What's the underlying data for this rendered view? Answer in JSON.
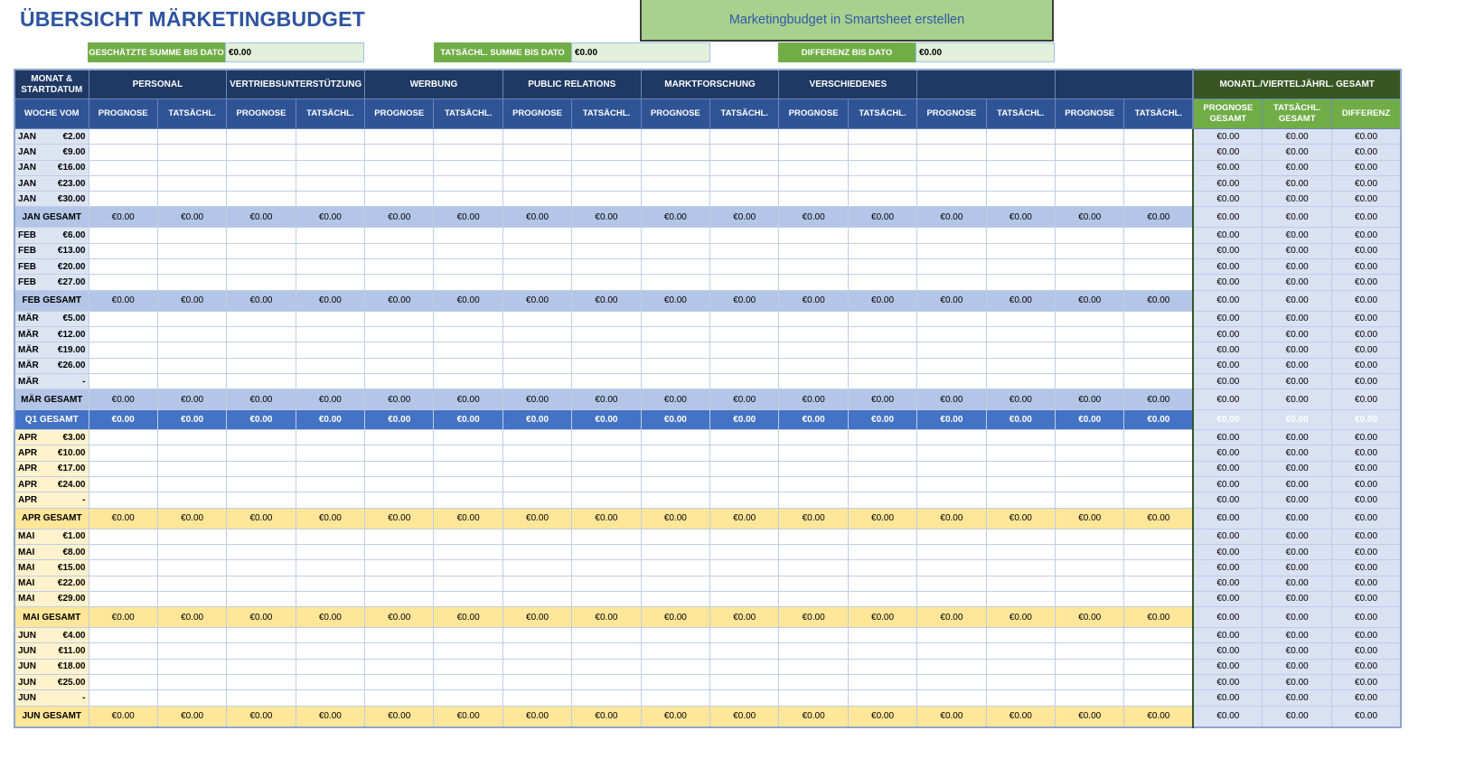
{
  "title": "ÜBERSICHT MÄRKETINGBUDGET",
  "smartsheet_link": "Marketingbudget in Smartsheet erstellen",
  "summaries": [
    {
      "label": "GESCHÄTZTE SUMME BIS DATO",
      "value": "€0.00",
      "color": "#70ad47"
    },
    {
      "label": "TATSÄCHL. SUMME BIS DATO",
      "value": "€0.00",
      "color": "#70ad47"
    },
    {
      "label": "DIFFERENZ BIS DATO",
      "value": "€0.00",
      "color": "#70ad47"
    }
  ],
  "header": {
    "month_col": "MONAT & STARTDATUM",
    "week_col": "WOCHE VOM",
    "categories": [
      "PERSONAL",
      "VERTRIEBSUNTERSTÜTZUNG",
      "WERBUNG",
      "PUBLIC RELATIONS",
      "MARKTFORSCHUNG",
      "VERSCHIEDENES",
      "",
      ""
    ],
    "forecast": "PROGNOSE",
    "actual": "TATSÄCHL.",
    "total_group": "MONATL./VIERTELJÄHRL. GESAMT",
    "total_cols": [
      "PROGNOSE GESAMT",
      "TATSÄCHL. GESAMT",
      "DIFFERENZ"
    ]
  },
  "zero": "€0.00",
  "rows": [
    {
      "t": "wk",
      "q": 1,
      "m": "JAN",
      "d": "€2.00"
    },
    {
      "t": "wk",
      "q": 1,
      "m": "JAN",
      "d": "€9.00"
    },
    {
      "t": "wk",
      "q": 1,
      "m": "JAN",
      "d": "€16.00"
    },
    {
      "t": "wk",
      "q": 1,
      "m": "JAN",
      "d": "€23.00"
    },
    {
      "t": "wk",
      "q": 1,
      "m": "JAN",
      "d": "€30.00"
    },
    {
      "t": "mt",
      "q": 1,
      "label": "JAN GESAMT"
    },
    {
      "t": "wk",
      "q": 1,
      "m": "FEB",
      "d": "€6.00"
    },
    {
      "t": "wk",
      "q": 1,
      "m": "FEB",
      "d": "€13.00"
    },
    {
      "t": "wk",
      "q": 1,
      "m": "FEB",
      "d": "€20.00"
    },
    {
      "t": "wk",
      "q": 1,
      "m": "FEB",
      "d": "€27.00"
    },
    {
      "t": "mt",
      "q": 1,
      "label": "FEB GESAMT"
    },
    {
      "t": "wk",
      "q": 1,
      "m": "MÄR",
      "d": "€5.00"
    },
    {
      "t": "wk",
      "q": 1,
      "m": "MÄR",
      "d": "€12.00"
    },
    {
      "t": "wk",
      "q": 1,
      "m": "MÄR",
      "d": "€19.00"
    },
    {
      "t": "wk",
      "q": 1,
      "m": "MÄR",
      "d": "€26.00"
    },
    {
      "t": "wk",
      "q": 1,
      "m": "MÄR",
      "d": "-"
    },
    {
      "t": "mt",
      "q": 1,
      "label": "MÄR GESAMT"
    },
    {
      "t": "qt",
      "q": 1,
      "label": "Q1 GESAMT"
    },
    {
      "t": "wk",
      "q": 2,
      "m": "APR",
      "d": "€3.00"
    },
    {
      "t": "wk",
      "q": 2,
      "m": "APR",
      "d": "€10.00"
    },
    {
      "t": "wk",
      "q": 2,
      "m": "APR",
      "d": "€17.00"
    },
    {
      "t": "wk",
      "q": 2,
      "m": "APR",
      "d": "€24.00"
    },
    {
      "t": "wk",
      "q": 2,
      "m": "APR",
      "d": "-"
    },
    {
      "t": "mt",
      "q": 2,
      "label": "APR GESAMT"
    },
    {
      "t": "wk",
      "q": 2,
      "m": "MAI",
      "d": "€1.00"
    },
    {
      "t": "wk",
      "q": 2,
      "m": "MAI",
      "d": "€8.00"
    },
    {
      "t": "wk",
      "q": 2,
      "m": "MAI",
      "d": "€15.00"
    },
    {
      "t": "wk",
      "q": 2,
      "m": "MAI",
      "d": "€22.00"
    },
    {
      "t": "wk",
      "q": 2,
      "m": "MAI",
      "d": "€29.00"
    },
    {
      "t": "mt",
      "q": 2,
      "label": "MAI GESAMT"
    },
    {
      "t": "wk",
      "q": 2,
      "m": "JUN",
      "d": "€4.00"
    },
    {
      "t": "wk",
      "q": 2,
      "m": "JUN",
      "d": "€11.00"
    },
    {
      "t": "wk",
      "q": 2,
      "m": "JUN",
      "d": "€18.00"
    },
    {
      "t": "wk",
      "q": 2,
      "m": "JUN",
      "d": "€25.00"
    },
    {
      "t": "wk",
      "q": 2,
      "m": "JUN",
      "d": "-"
    },
    {
      "t": "mt",
      "q": 2,
      "label": "JUN GESAMT"
    }
  ]
}
